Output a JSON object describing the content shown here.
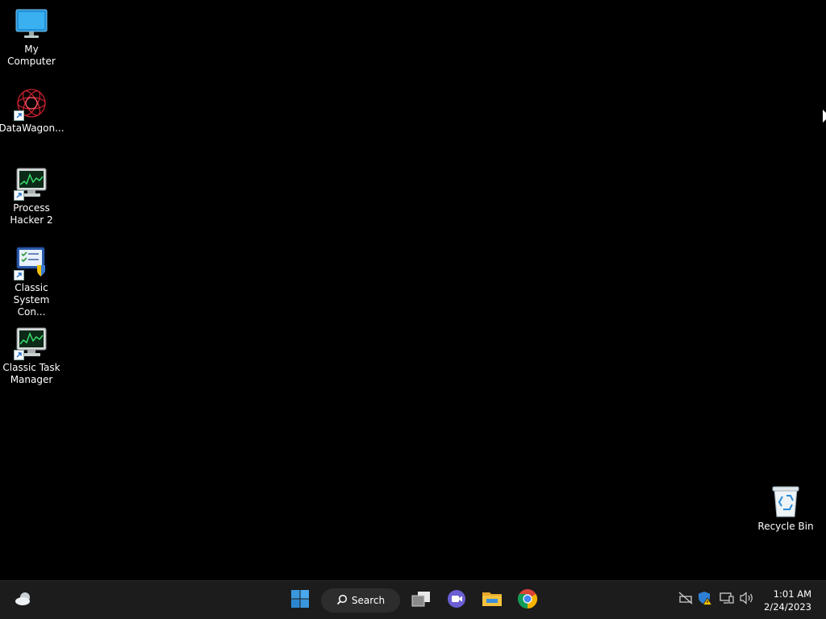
{
  "desktop": {
    "icons": [
      {
        "label": "My Computer",
        "icon": "monitor-icon",
        "shortcut": false
      },
      {
        "label": "DataWagon...",
        "icon": "datawagon-icon",
        "shortcut": true
      },
      {
        "label": "Process\nHacker 2",
        "icon": "process-hacker-icon",
        "shortcut": true
      },
      {
        "label": "Classic\nSystem Con...",
        "icon": "system-config-icon",
        "shortcut": true
      },
      {
        "label": "Classic Task\nManager",
        "icon": "task-manager-icon",
        "shortcut": true
      },
      {
        "label": "Recycle Bin",
        "icon": "recycle-bin-icon",
        "shortcut": false
      }
    ]
  },
  "taskbar": {
    "search_label": "Search",
    "items": [
      "weather-icon",
      "start-icon",
      "search-icon",
      "task-view-icon",
      "chat-icon",
      "file-explorer-icon",
      "chrome-icon"
    ],
    "tray": [
      "network-off-icon",
      "security-warning-icon",
      "display-icon",
      "volume-icon"
    ],
    "clock": {
      "time": "1:01 AM",
      "date": "2/24/2023"
    }
  },
  "colors": {
    "desktop_bg": "#000000",
    "taskbar_bg": "#1c1c1c",
    "start_blue": "#3a96dd",
    "chat_purple": "#6b5fd3",
    "folder_yellow": "#f4c23d"
  }
}
